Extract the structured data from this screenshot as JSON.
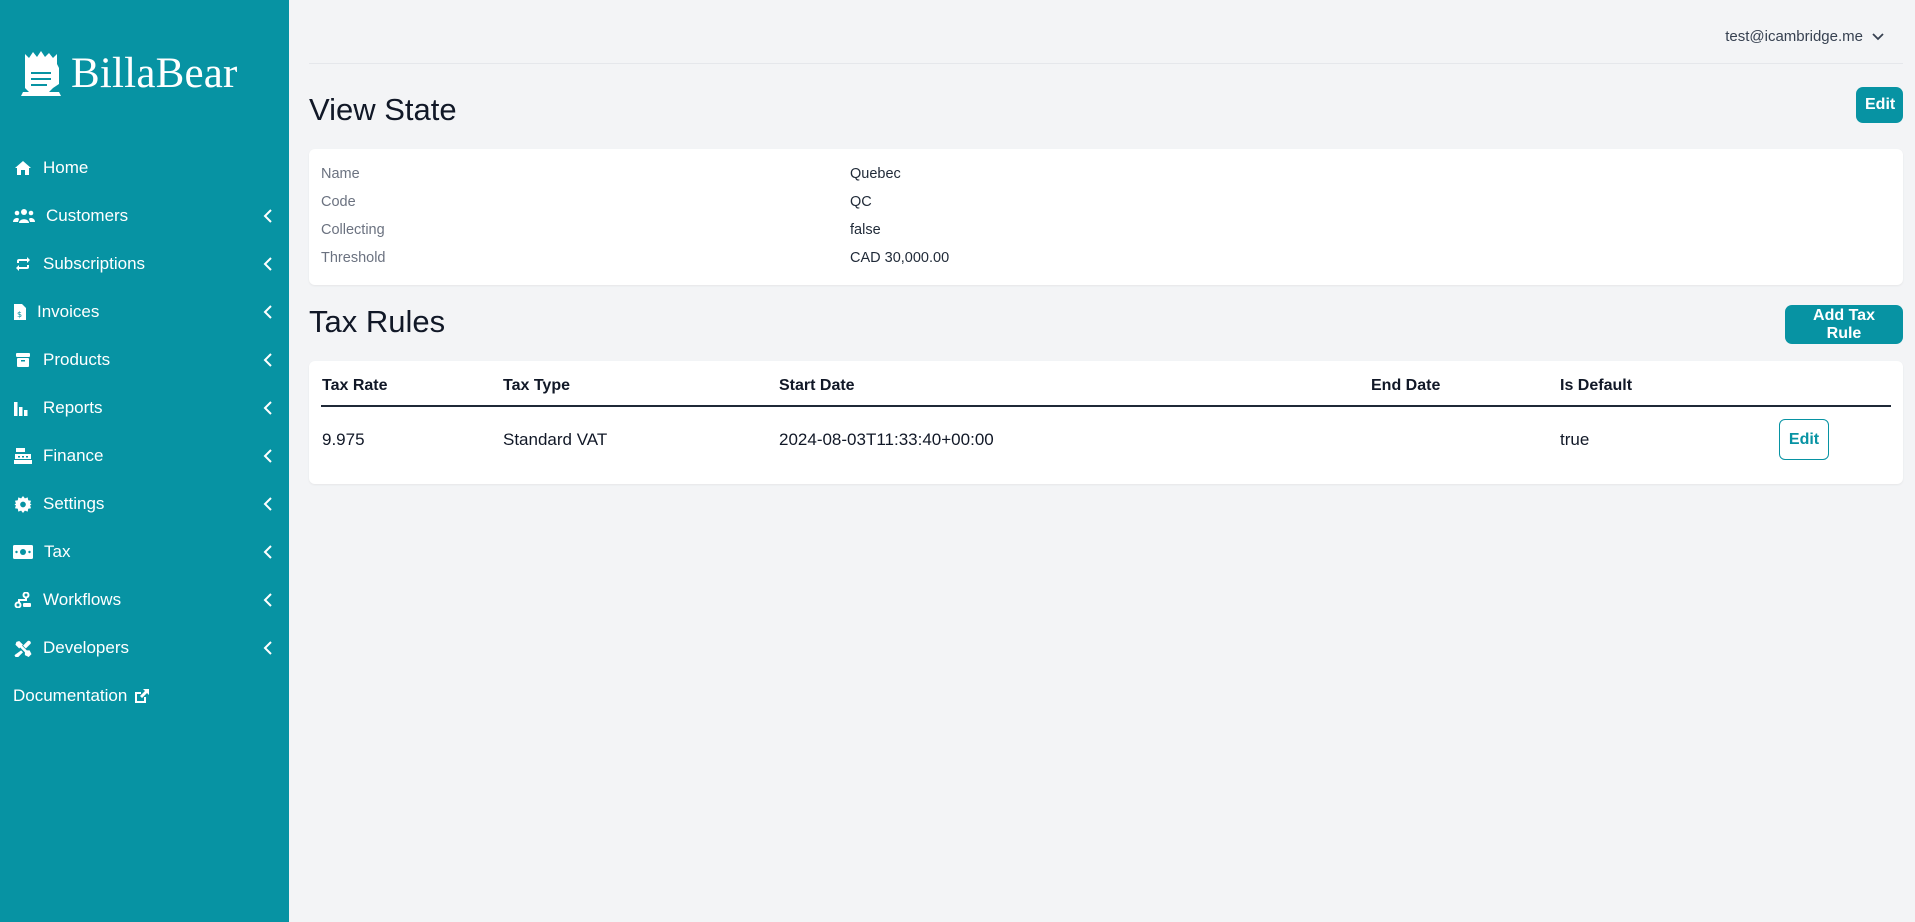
{
  "sidebar": {
    "brand": "BillaBear",
    "items": [
      {
        "label": "Home",
        "icon": "home-icon",
        "has_submenu": false
      },
      {
        "label": "Customers",
        "icon": "users-icon",
        "has_submenu": true
      },
      {
        "label": "Subscriptions",
        "icon": "repeat-icon",
        "has_submenu": true
      },
      {
        "label": "Invoices",
        "icon": "invoice-icon",
        "has_submenu": true
      },
      {
        "label": "Products",
        "icon": "box-icon",
        "has_submenu": true
      },
      {
        "label": "Reports",
        "icon": "bar-chart-icon",
        "has_submenu": true
      },
      {
        "label": "Finance",
        "icon": "cash-register-icon",
        "has_submenu": true
      },
      {
        "label": "Settings",
        "icon": "gear-icon",
        "has_submenu": true
      },
      {
        "label": "Tax",
        "icon": "money-bill-icon",
        "has_submenu": true
      },
      {
        "label": "Workflows",
        "icon": "workflow-icon",
        "has_submenu": true
      },
      {
        "label": "Developers",
        "icon": "tools-icon",
        "has_submenu": true
      }
    ],
    "documentation": {
      "label": "Documentation",
      "icon": "external-link-icon"
    }
  },
  "header": {
    "user_email": "test@icambridge.me"
  },
  "state": {
    "title": "View State",
    "edit_label": "Edit",
    "fields": [
      {
        "label": "Name",
        "value": "Quebec"
      },
      {
        "label": "Code",
        "value": "QC"
      },
      {
        "label": "Collecting",
        "value": "false"
      },
      {
        "label": "Threshold",
        "value": "CAD 30,000.00"
      }
    ]
  },
  "tax_rules": {
    "title": "Tax Rules",
    "add_label": "Add Tax Rule",
    "columns": [
      "Tax Rate",
      "Tax Type",
      "Start Date",
      "End Date",
      "Is Default"
    ],
    "rows": [
      {
        "tax_rate": "9.975",
        "tax_type": "Standard VAT",
        "start_date": "2024-08-03T11:33:40+00:00",
        "end_date": "",
        "is_default": "true",
        "edit_label": "Edit"
      }
    ]
  },
  "colors": {
    "brand": "#0793a3",
    "background": "#f3f4f6"
  }
}
